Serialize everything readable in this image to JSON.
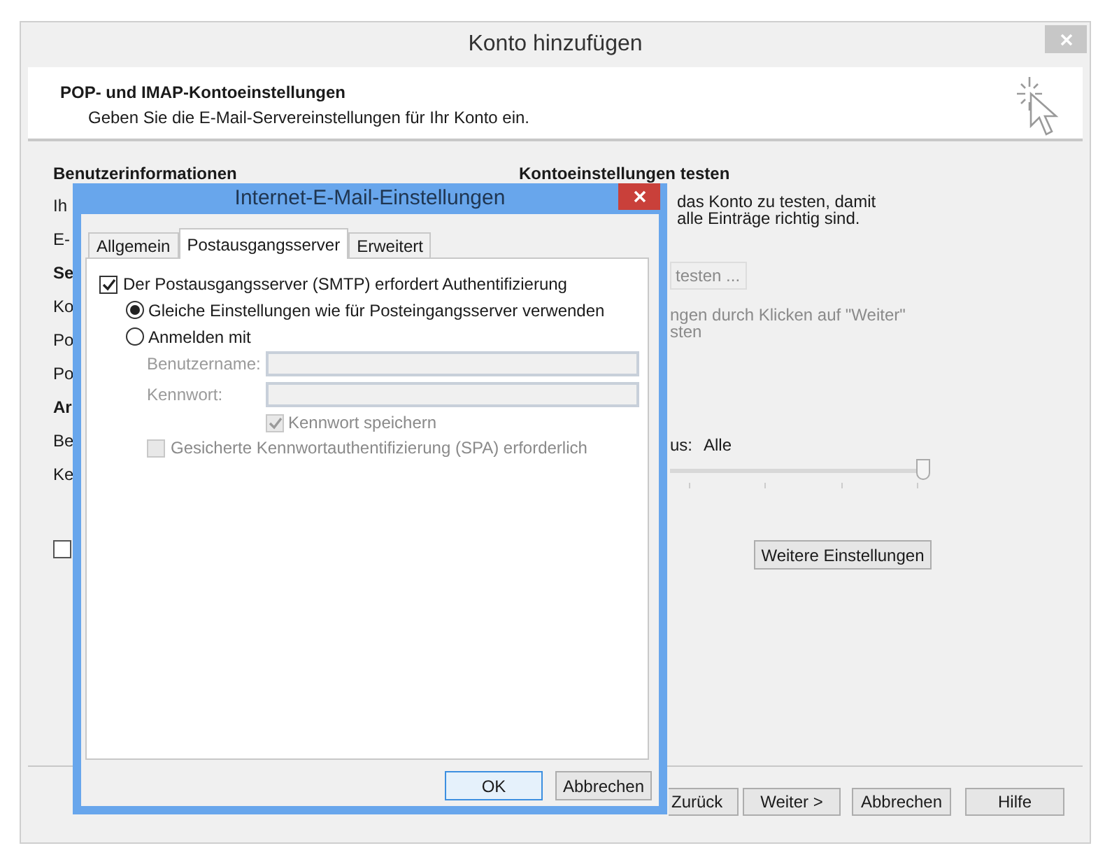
{
  "window": {
    "title": "Konto hinzufügen"
  },
  "header": {
    "title": "POP- und IMAP-Kontoeinstellungen",
    "subtitle": "Geben Sie die E-Mail-Servereinstellungen für Ihr Konto ein."
  },
  "user_info": {
    "heading": "Benutzerinformationen",
    "fragments": [
      {
        "text": "Ih",
        "kind": "label"
      },
      {
        "text": "E-",
        "kind": "label"
      },
      {
        "text": "Se",
        "kind": "heading"
      },
      {
        "text": "Ko",
        "kind": "label"
      },
      {
        "text": "Po",
        "kind": "label"
      },
      {
        "text": "Po",
        "kind": "label"
      },
      {
        "text": "Ar",
        "kind": "heading"
      },
      {
        "text": "Be",
        "kind": "label"
      },
      {
        "text": "Ke",
        "kind": "label"
      }
    ]
  },
  "left_checkbox": {
    "checked": false
  },
  "test_section": {
    "heading": "Kontoeinstellungen testen",
    "lines": [
      "das Konto zu testen, damit",
      "alle Einträge richtig sind."
    ],
    "button": {
      "label": "testen ...",
      "disabled": true
    },
    "note": {
      "lines": [
        "ngen durch Klicken auf \"Weiter\"",
        "sten"
      ],
      "disabled": true
    },
    "slider": {
      "label": "us:",
      "value": "Alle",
      "level": 1
    },
    "more_button": "Weitere Einstellungen"
  },
  "footer_buttons": [
    {
      "label": "Zurück"
    },
    {
      "label": "Weiter >"
    },
    {
      "label": "Abbrechen"
    },
    {
      "label": "Hilfe"
    }
  ],
  "dialog": {
    "title": "Internet-E-Mail-Einstellungen",
    "tabs": [
      {
        "label": "Allgemein",
        "selected": false
      },
      {
        "label": "Postausgangsserver",
        "selected": true
      },
      {
        "label": "Erweitert",
        "selected": false
      }
    ],
    "smtp_auth": {
      "label": "Der Postausgangsserver (SMTP) erfordert Authentifizierung",
      "checked": true
    },
    "options": [
      {
        "label": "Gleiche Einstellungen wie für Posteingangsserver verwenden",
        "selected": true
      },
      {
        "label": "Anmelden mit",
        "selected": false
      }
    ],
    "fields": [
      {
        "label": "Benutzername:",
        "disabled": true
      },
      {
        "label": "Kennwort:",
        "disabled": true
      }
    ],
    "save_password": {
      "label": "Kennwort speichern",
      "checked": true,
      "disabled": true
    },
    "spa": {
      "label": "Gesicherte Kennwortauthentifizierung (SPA) erforderlich",
      "checked": false,
      "disabled": true
    },
    "buttons": [
      {
        "label": "OK",
        "default": true
      },
      {
        "label": "Abbrechen",
        "default": false
      }
    ]
  }
}
